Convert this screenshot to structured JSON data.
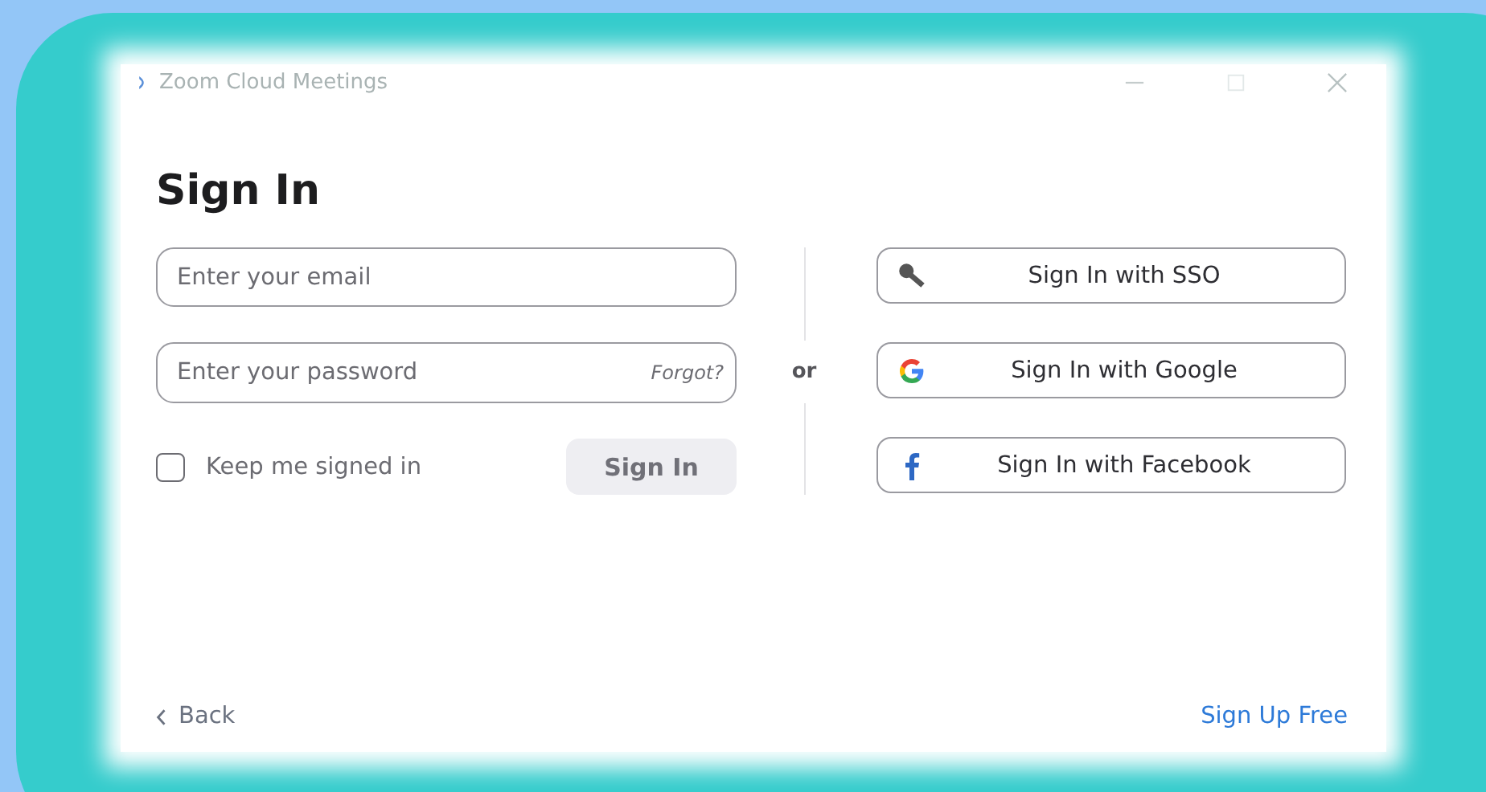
{
  "window": {
    "title": "Zoom Cloud Meetings"
  },
  "heading": "Sign In",
  "email": {
    "placeholder": "Enter your email"
  },
  "password": {
    "placeholder": "Enter your password",
    "forgot_link": "Forgot?"
  },
  "keep_signed_in": {
    "label": "Keep me signed in",
    "checked": false
  },
  "sign_in_button": {
    "label": "Sign In",
    "disabled": true
  },
  "separator": "or",
  "providers": [
    {
      "kind": "sso",
      "label": "Sign In with SSO"
    },
    {
      "kind": "google",
      "label": "Sign In with Google"
    },
    {
      "kind": "facebook",
      "label": "Sign In with Facebook"
    }
  ],
  "footer": {
    "back": "Back",
    "sign_up": "Sign Up Free"
  }
}
